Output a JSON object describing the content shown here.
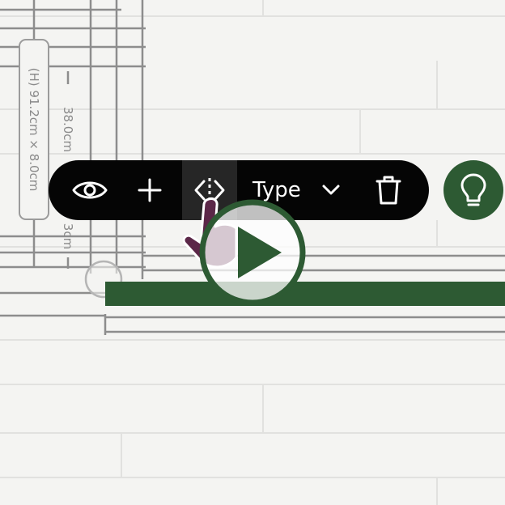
{
  "canvas": {
    "width_dimension": "38.0cm",
    "depth_dimension": "3cm",
    "size_label": "(H) 91.2cm × 8.0cm",
    "selected_item_color": "#2d5a33"
  },
  "toolbar": {
    "view_icon": "eye-icon",
    "add_icon": "plus-icon",
    "flip_icon": "flip-horizontal-icon",
    "type_label": "Type",
    "type_icon": "chevron-down-icon",
    "delete_icon": "trash-icon"
  },
  "idea_button": {
    "icon": "lightbulb-icon",
    "color": "#2d5a33"
  },
  "video_overlay": {
    "icon": "play-icon",
    "color": "#2d5a33"
  }
}
